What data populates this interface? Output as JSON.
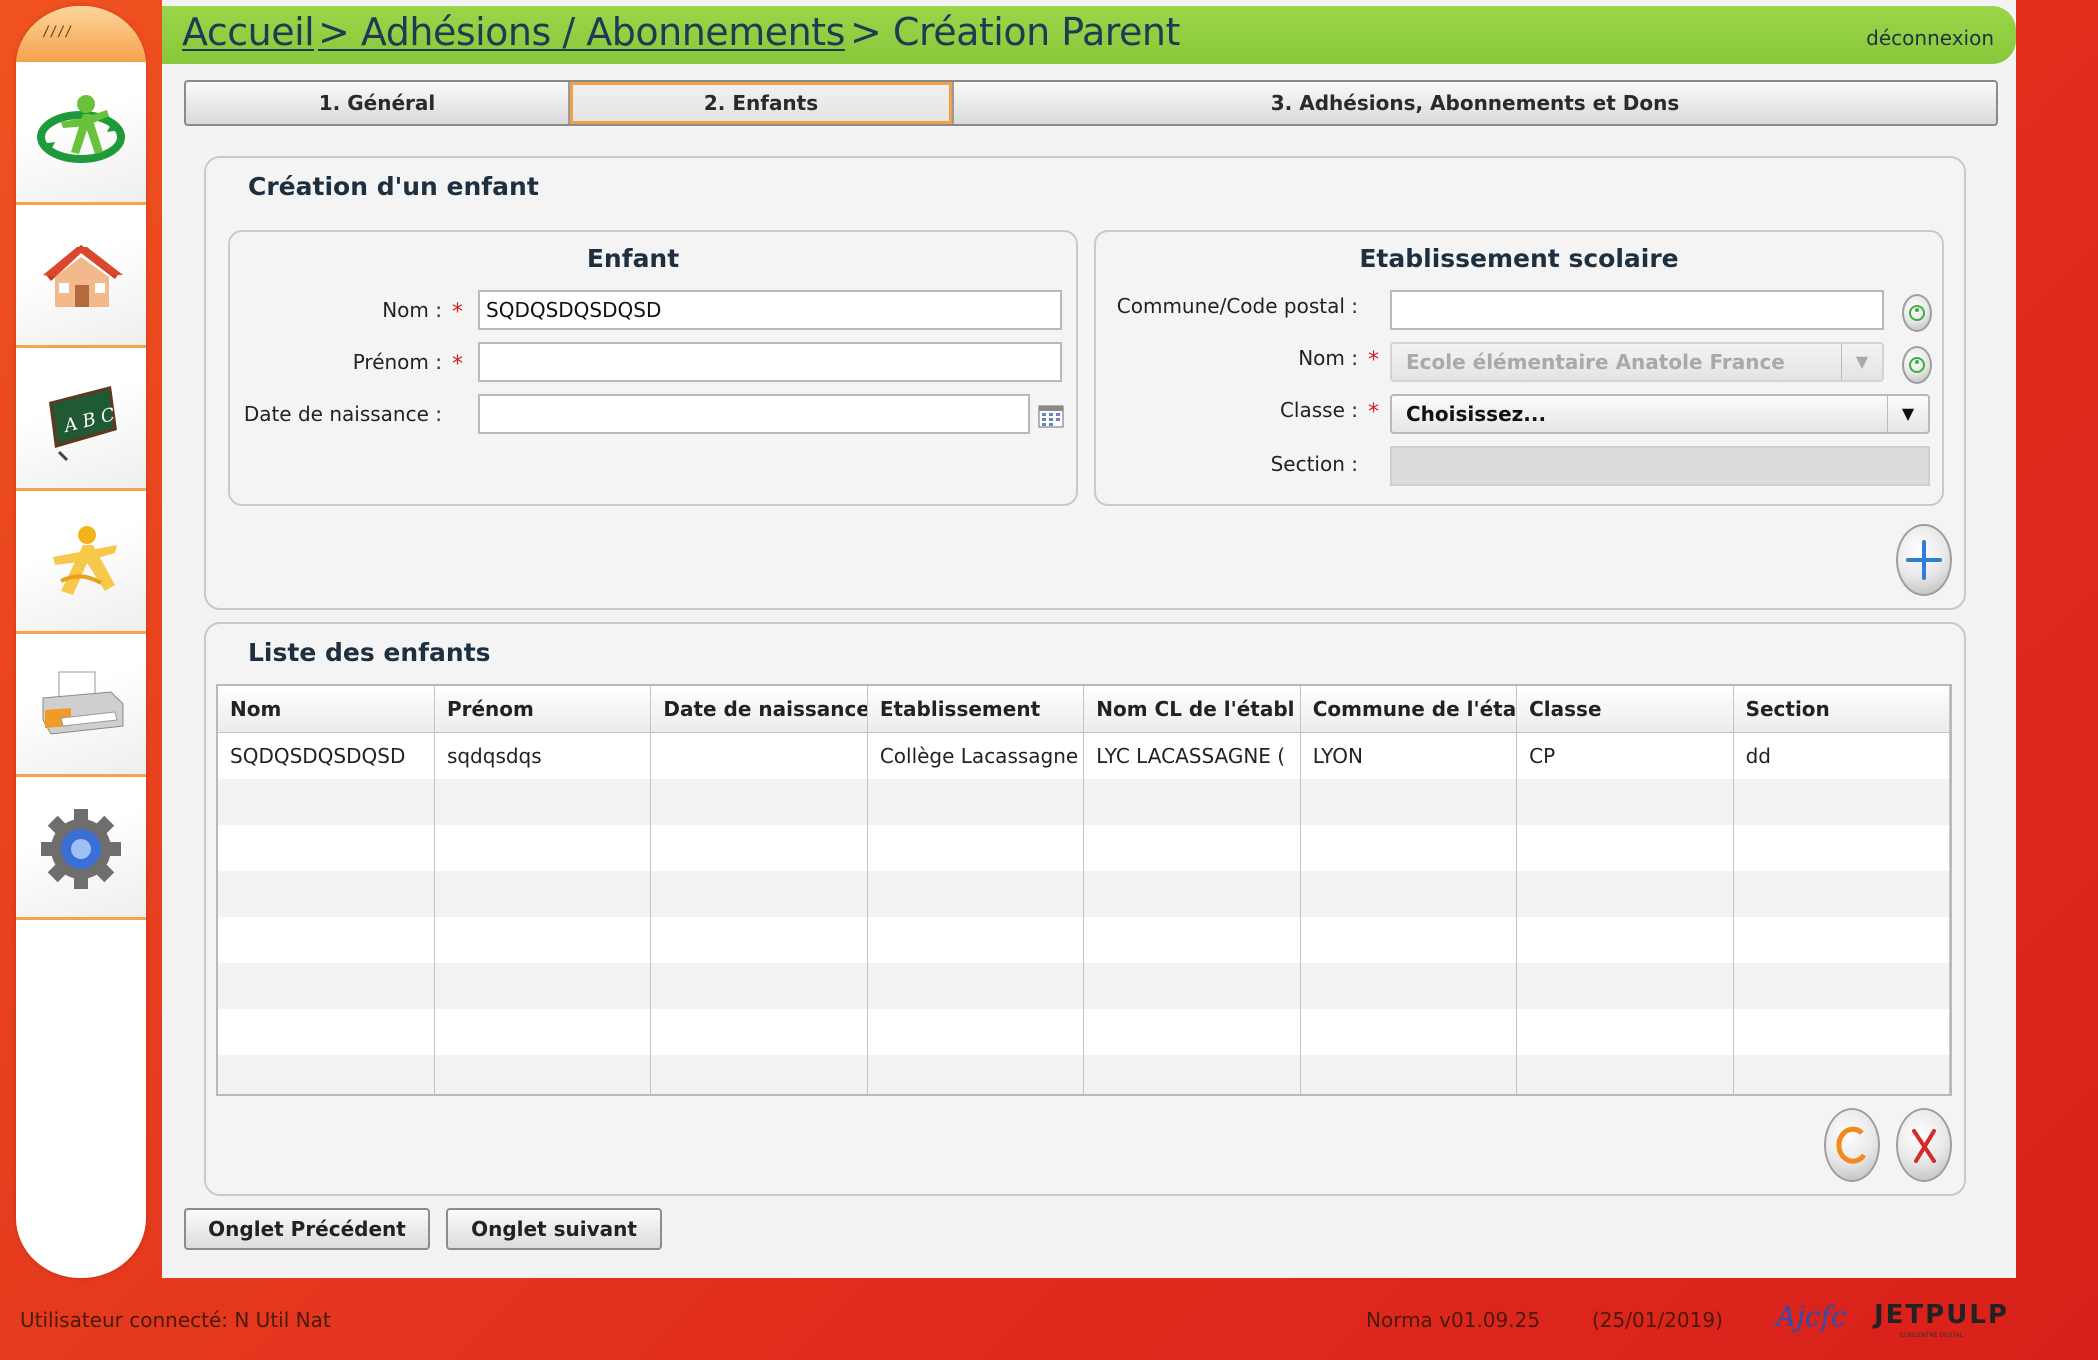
{
  "breadcrumb": {
    "home": "Accueil",
    "section": "> Adhésions / Abonnements",
    "current": "> Création Parent"
  },
  "header": {
    "logout": "déconnexion"
  },
  "tabs": [
    {
      "label": "1. Général",
      "active": false
    },
    {
      "label": "2. Enfants",
      "active": true
    },
    {
      "label": "3. Adhésions, Abonnements et Dons",
      "active": false
    }
  ],
  "creation_panel": {
    "title": "Création d'un enfant",
    "child": {
      "title": "Enfant",
      "nom_label": "Nom :",
      "nom_value": "SQDQSDQSDQSD",
      "prenom_label": "Prénom :",
      "prenom_value": "",
      "birthdate_label": "Date de naissance :",
      "birthdate_value": ""
    },
    "school": {
      "title": "Etablissement scolaire",
      "commune_label": "Commune/Code postal :",
      "commune_value": "",
      "nom_label": "Nom :",
      "nom_value": "Ecole élémentaire Anatole France",
      "classe_label": "Classe :",
      "classe_value": "Choisissez...",
      "section_label": "Section :",
      "section_value": ""
    },
    "required_mark": "*"
  },
  "list_panel": {
    "title": "Liste des enfants",
    "columns": [
      "Nom",
      "Prénom",
      "Date de naissance",
      "Etablissement",
      "Nom CL de l'établ",
      "Commune de l'éta",
      "Classe",
      "Section"
    ],
    "rows": [
      [
        "SQDQSDQSDQSD",
        "sqdqsdqs",
        "",
        "Collège Lacassagne",
        "LYC LACASSAGNE (",
        "LYON",
        "CP",
        "dd"
      ]
    ]
  },
  "buttons": {
    "previous": "Onglet Précédent",
    "next": "Onglet suivant"
  },
  "sidebar": {
    "grip": "////",
    "items": [
      "recycle-person-icon",
      "home-icon",
      "chalkboard-icon",
      "star-person-icon",
      "printer-icon",
      "gear-icon"
    ]
  },
  "footer": {
    "user": "Utilisateur connecté: N Util Nat",
    "version": "Norma v01.09.25",
    "date": "(25/01/2019)",
    "brand1": "Ajcfc",
    "brand2": "JETPULP",
    "brand2_sub": "CONCENTRÉ DIGITAL"
  },
  "colors": {
    "accent_green": "#8dcb3d",
    "tab_active_border": "#f0a04a",
    "required": "#d42020",
    "background_red": "#e53a1e"
  }
}
